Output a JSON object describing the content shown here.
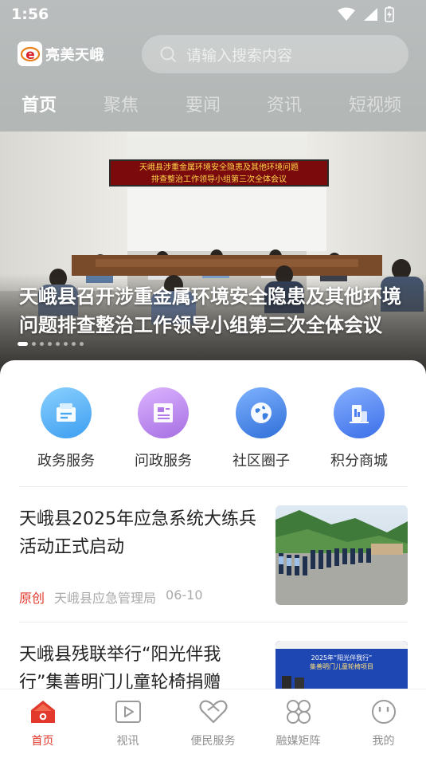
{
  "status": {
    "time": "1:56"
  },
  "header": {
    "logo_text": "亮美天峨",
    "search_placeholder": "请输入搜索内容",
    "tabs": [
      {
        "label": "首页",
        "active": true
      },
      {
        "label": "聚焦",
        "active": false
      },
      {
        "label": "要闻",
        "active": false
      },
      {
        "label": "资讯",
        "active": false
      },
      {
        "label": "短视频",
        "active": false
      }
    ]
  },
  "hero": {
    "banner_text_line1": "天峨县涉重金属环境安全隐患及其他环境问题",
    "banner_text_line2": "排查整治工作领导小组第三次全体会议",
    "title": "天峨县召开涉重金属环境安全隐患及其他环境问题排查整治工作领导小组第三次全体会议",
    "slides": 8,
    "active_slide": 1
  },
  "services": [
    {
      "label": "政务服务",
      "icon": "government-service-icon",
      "color": "#4aa8f0"
    },
    {
      "label": "问政服务",
      "icon": "document-icon",
      "color": "#b07be6"
    },
    {
      "label": "社区圈子",
      "icon": "globe-icon",
      "color": "#3d7fe0"
    },
    {
      "label": "积分商城",
      "icon": "shop-building-icon",
      "color": "#4b7ff0"
    }
  ],
  "news": [
    {
      "title": "天峨县2025年应急系统大练兵活动正式启动",
      "tag": "原创",
      "source": "天峨县应急管理局",
      "date": "06-10"
    },
    {
      "title": "天峨县残联举行“阳光伴我行”集善明门儿童轮椅捐赠",
      "thumb_banner": "2025年“阳光伴我行”集善明门儿童轮椅项目"
    }
  ],
  "bottom_nav": [
    {
      "label": "首页",
      "icon": "home-icon",
      "active": true
    },
    {
      "label": "视讯",
      "icon": "video-icon",
      "active": false
    },
    {
      "label": "便民服务",
      "icon": "heart-service-icon",
      "active": false
    },
    {
      "label": "融媒矩阵",
      "icon": "grid-icon",
      "active": false
    },
    {
      "label": "我的",
      "icon": "profile-icon",
      "active": false
    }
  ],
  "colors": {
    "accent": "#e2392c",
    "tag": "#e23b2e"
  }
}
